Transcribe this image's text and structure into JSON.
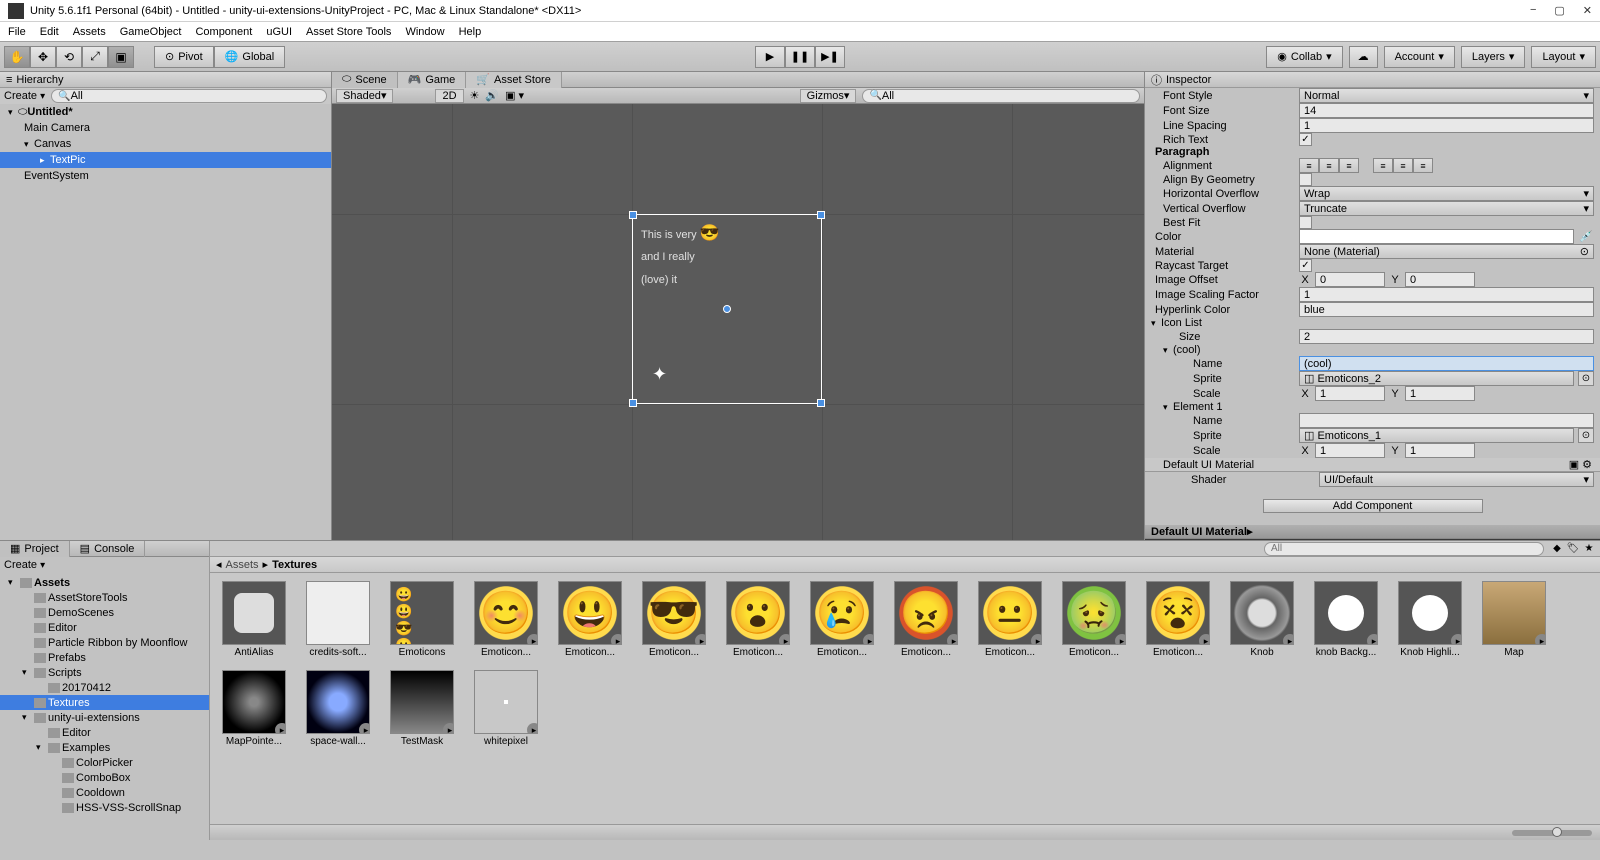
{
  "window": {
    "title": "Unity 5.6.1f1 Personal (64bit) - Untitled - unity-ui-extensions-UnityProject - PC, Mac & Linux Standalone* <DX11>"
  },
  "menu": [
    "File",
    "Edit",
    "Assets",
    "GameObject",
    "Component",
    "uGUI",
    "Asset Store Tools",
    "Window",
    "Help"
  ],
  "toolbar": {
    "pivot": "Pivot",
    "global": "Global",
    "collab": "Collab",
    "account": "Account",
    "layers": "Layers",
    "layout": "Layout"
  },
  "hierarchy": {
    "title": "Hierarchy",
    "create": "Create ",
    "search_placeholder": "All",
    "root": "Untitled*",
    "items": [
      "Main Camera",
      "Canvas",
      "TextPic",
      "EventSystem"
    ]
  },
  "scenetabs": {
    "scene": "Scene",
    "game": "Game",
    "assetstore": "Asset Store"
  },
  "scenebar": {
    "shaded": "Shaded",
    "mode2d": "2D",
    "gizmos": "Gizmos",
    "search": "All"
  },
  "scene_text": {
    "line1": "This is very ",
    "emoji": "😎",
    "line2": "and I really",
    "line3": "(love) it"
  },
  "inspector": {
    "title": "Inspector",
    "fontStyle": {
      "label": "Font Style",
      "value": "Normal"
    },
    "fontSize": {
      "label": "Font Size",
      "value": "14"
    },
    "lineSpacing": {
      "label": "Line Spacing",
      "value": "1"
    },
    "richText": {
      "label": "Rich Text",
      "checked": true
    },
    "paragraph": "Paragraph",
    "alignment": "Alignment",
    "alignByGeo": "Align By Geometry",
    "hOverflow": {
      "label": "Horizontal Overflow",
      "value": "Wrap"
    },
    "vOverflow": {
      "label": "Vertical Overflow",
      "value": "Truncate"
    },
    "bestFit": "Best Fit",
    "color": "Color",
    "material": {
      "label": "Material",
      "value": "None (Material)"
    },
    "raycast": "Raycast Target",
    "imageOffset": {
      "label": "Image Offset",
      "x": "0",
      "y": "0"
    },
    "imageScaling": {
      "label": "Image Scaling Factor",
      "value": "1"
    },
    "hyperlinkColor": {
      "label": "Hyperlink Color",
      "value": "blue"
    },
    "iconList": "Icon List",
    "size": {
      "label": "Size",
      "value": "2"
    },
    "cool": {
      "header": "(cool)",
      "name_label": "Name",
      "name_value": "(cool)",
      "sprite_label": "Sprite",
      "sprite_value": "Emoticons_2",
      "scale_label": "Scale",
      "scale_x": "1",
      "scale_y": "1"
    },
    "elem1": {
      "header": "Element 1",
      "name_label": "Name",
      "name_value": "",
      "sprite_label": "Sprite",
      "sprite_value": "Emoticons_1",
      "scale_label": "Scale",
      "scale_x": "1",
      "scale_y": "1"
    },
    "defaultMat": "Default UI Material",
    "shader": {
      "label": "Shader",
      "value": "UI/Default"
    },
    "addComponent": "Add Component"
  },
  "project": {
    "title": "Project",
    "console": "Console",
    "create": "Create ",
    "breadcrumb": [
      "Assets",
      "Textures"
    ],
    "tree": [
      {
        "name": "Assets",
        "lvl": 0,
        "expanded": true,
        "bold": true
      },
      {
        "name": "AssetStoreTools",
        "lvl": 1
      },
      {
        "name": "DemoScenes",
        "lvl": 1
      },
      {
        "name": "Editor",
        "lvl": 1
      },
      {
        "name": "Particle Ribbon by Moonflow",
        "lvl": 1
      },
      {
        "name": "Prefabs",
        "lvl": 1
      },
      {
        "name": "Scripts",
        "lvl": 1,
        "expanded": true
      },
      {
        "name": "20170412",
        "lvl": 2
      },
      {
        "name": "Textures",
        "lvl": 1,
        "selected": true
      },
      {
        "name": "unity-ui-extensions",
        "lvl": 1,
        "expanded": true
      },
      {
        "name": "Editor",
        "lvl": 2
      },
      {
        "name": "Examples",
        "lvl": 2,
        "expanded": true
      },
      {
        "name": "ColorPicker",
        "lvl": 3
      },
      {
        "name": "ComboBox",
        "lvl": 3
      },
      {
        "name": "Cooldown",
        "lvl": 3
      },
      {
        "name": "HSS-VSS-ScrollSnap",
        "lvl": 3
      }
    ],
    "assets": [
      {
        "name": "AntiAlias",
        "type": "square"
      },
      {
        "name": "credits-soft...",
        "type": "white"
      },
      {
        "name": "Emoticons",
        "type": "sheet"
      },
      {
        "name": "Emoticon...",
        "type": "emoji",
        "play": true,
        "face": "😊"
      },
      {
        "name": "Emoticon...",
        "type": "emoji",
        "play": true,
        "face": "😃"
      },
      {
        "name": "Emoticon...",
        "type": "emoji",
        "play": true,
        "face": "😎"
      },
      {
        "name": "Emoticon...",
        "type": "emoji",
        "play": true,
        "face": "😮"
      },
      {
        "name": "Emoticon...",
        "type": "emoji",
        "play": true,
        "face": "😢"
      },
      {
        "name": "Emoticon...",
        "type": "emoji",
        "play": true,
        "face": "😠",
        "bg": "#d9532b"
      },
      {
        "name": "Emoticon...",
        "type": "emoji",
        "play": true,
        "face": "😐"
      },
      {
        "name": "Emoticon...",
        "type": "emoji",
        "play": true,
        "face": "🤢",
        "bg": "#7fc241"
      },
      {
        "name": "Emoticon...",
        "type": "emoji",
        "play": true,
        "face": "😵"
      },
      {
        "name": "Knob",
        "type": "knob",
        "play": true
      },
      {
        "name": "knob Backg...",
        "type": "circle",
        "play": true
      },
      {
        "name": "Knob Highli...",
        "type": "circle",
        "play": true
      },
      {
        "name": "Map",
        "type": "map",
        "play": true
      },
      {
        "name": "MapPointe...",
        "type": "dark",
        "play": true
      },
      {
        "name": "space-wall...",
        "type": "space",
        "play": true
      },
      {
        "name": "TestMask",
        "type": "mask",
        "play": true
      },
      {
        "name": "whitepixel",
        "type": "pixel",
        "play": true
      }
    ]
  }
}
